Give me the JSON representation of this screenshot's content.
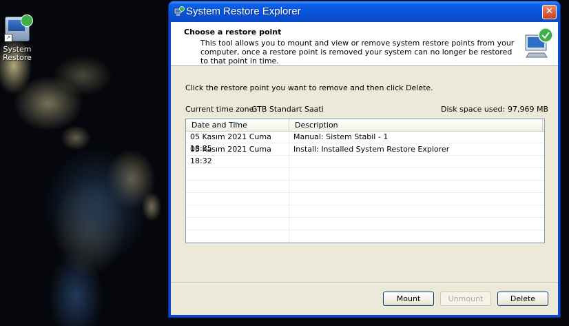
{
  "desktop": {
    "icon_label": "System Restore"
  },
  "window": {
    "title": "System Restore Explorer",
    "close_glyph": "✕",
    "header": {
      "title": "Choose a restore point",
      "description": "This tool allows you to mount and view or remove system restore points from your computer, once a restore point is removed your system can no longer be restored to that point in time."
    },
    "instruction": "Click the restore point you want to remove and then click Delete.",
    "timezone": {
      "label": "Current time zone:",
      "value": "GTB Standart Saati"
    },
    "disk_space": {
      "label": "Disk space used:",
      "value": "97,969 MB"
    },
    "list": {
      "columns": [
        "Date and Time",
        "Description"
      ],
      "rows": [
        {
          "date": "05 Kasım 2021 Cuma 18:35",
          "description": "Manual: Sistem Stabil - 1"
        },
        {
          "date": "05 Kasım 2021 Cuma 18:32",
          "description": "Install: Installed System Restore Explorer"
        }
      ]
    },
    "buttons": {
      "mount": "Mount",
      "unmount": "Unmount",
      "delete": "Delete"
    }
  },
  "colors": {
    "titlebar": "#0b5ee8",
    "client": "#ece9d8",
    "close": "#c5421f"
  },
  "icons": [
    "system-restore-icon",
    "shortcut-arrow-icon",
    "close-icon",
    "sort-arrow-icon"
  ]
}
